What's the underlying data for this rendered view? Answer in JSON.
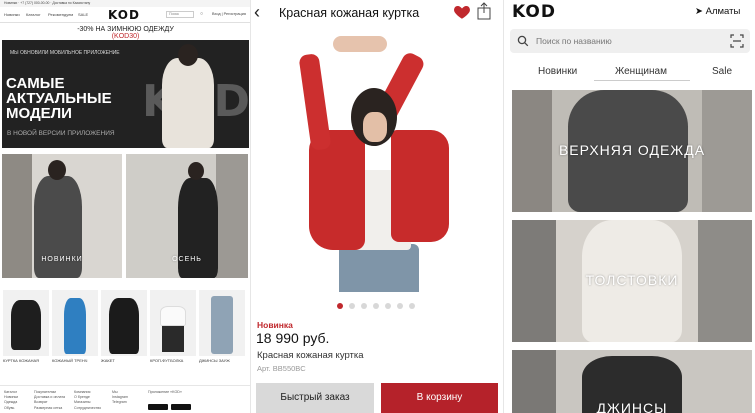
{
  "site": {
    "logo": "KOD",
    "top_bar": "Новинки · +7 (727) 000-00-00 · Доставка по Казахстану",
    "nav": [
      "Новинки",
      "Каталог",
      "Рекомендуем",
      "SALE"
    ],
    "search_placeholder": "Поиск",
    "login": "Вход | Регистрация",
    "promo": "-30% НА ЗИМНЮЮ ОДЕЖДУ",
    "promo_code": "(KOD30)",
    "banner": {
      "kicker": "МЫ ОБНОВИЛИ МОБИЛЬНОЕ ПРИЛОЖЕНИЕ",
      "headline_1": "САМЫЕ",
      "headline_2": "АКТУАЛЬНЫЕ",
      "headline_3": "МОДЕЛИ",
      "sub": "В НОВОЙ ВЕРСИИ ПРИЛОЖЕНИЯ",
      "watermark": "KOD"
    },
    "tiles": [
      "НОВИНКИ",
      "ОСЕНЬ"
    ],
    "products": [
      "КУРТКА КОЖАНАЯ",
      "КОЖАНЫЙ ТРЕНЧ",
      "ЖАКЕТ",
      "КРОП-ФУТБОЛКА",
      "ДЖИНСЫ ЗАУЖ"
    ],
    "footer": {
      "col1": [
        "Каталог",
        "Новинки",
        "Одежда",
        "Обувь",
        "Аксессуары"
      ],
      "col2": [
        "Покупателям",
        "Доставка и оплата",
        "Возврат",
        "Размерная сетка",
        "Программа лояльности"
      ],
      "col3": [
        "Компания",
        "О бренде",
        "Магазины",
        "Сотрудничество",
        "Вакансии"
      ],
      "col4": [
        "Мы",
        "Instagram",
        "Telegram"
      ],
      "col5": "Приложение «KOD»"
    }
  },
  "product": {
    "title": "Красная кожаная куртка",
    "badge": "Новинка",
    "price": "18 990 руб.",
    "name": "Красная кожаная куртка",
    "article": "Арт. BB550BC",
    "quick_order": "Быстрый заказ",
    "add_to_cart": "В корзину",
    "back_icon": "back-arrow-icon",
    "favorite_icon": "heart-icon",
    "share_icon": "share-icon",
    "gallery_count": 7,
    "gallery_active": 1
  },
  "catalog": {
    "logo": "KOD",
    "city": "Алматы",
    "search_placeholder": "Поиск по названию",
    "tabs": [
      "Новинки",
      "Женщинам",
      "Sale"
    ],
    "active_tab": "Женщинам",
    "categories": [
      "ВЕРХНЯЯ ОДЕЖДА",
      "ТОЛСТОВКИ",
      "ДЖИНСЫ"
    ]
  },
  "colors": {
    "accent": "#c0282d",
    "dark": "#2b2b2b",
    "button_grey": "#d9d9d9"
  }
}
